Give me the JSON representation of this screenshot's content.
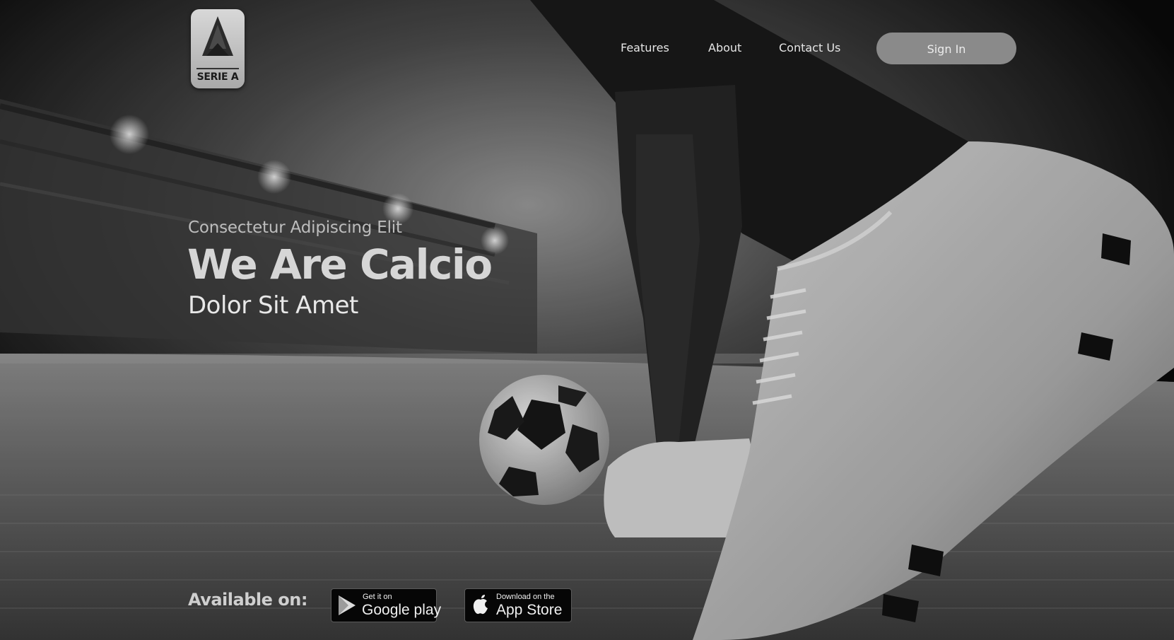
{
  "brand": {
    "logo_text": "SERIE A"
  },
  "nav": {
    "items": [
      {
        "label": "Features"
      },
      {
        "label": "About"
      },
      {
        "label": "Contact Us"
      }
    ],
    "sign_in_label": "Sign In"
  },
  "hero": {
    "eyebrow": "Consectetur Adipiscing Elit",
    "headline": "We Are Calcio",
    "subline": "Dolor Sit Amet"
  },
  "downloads": {
    "label": "Available on:",
    "google_play": {
      "small": "Get it on",
      "big": "Google play",
      "icon": "google-play-icon"
    },
    "app_store": {
      "small": "Download on the",
      "big": "App Store",
      "icon": "apple-icon"
    }
  },
  "colors": {
    "button_bg": "#8a8a8a",
    "text": "#e6e6e6",
    "background": "#0c0c0c"
  }
}
